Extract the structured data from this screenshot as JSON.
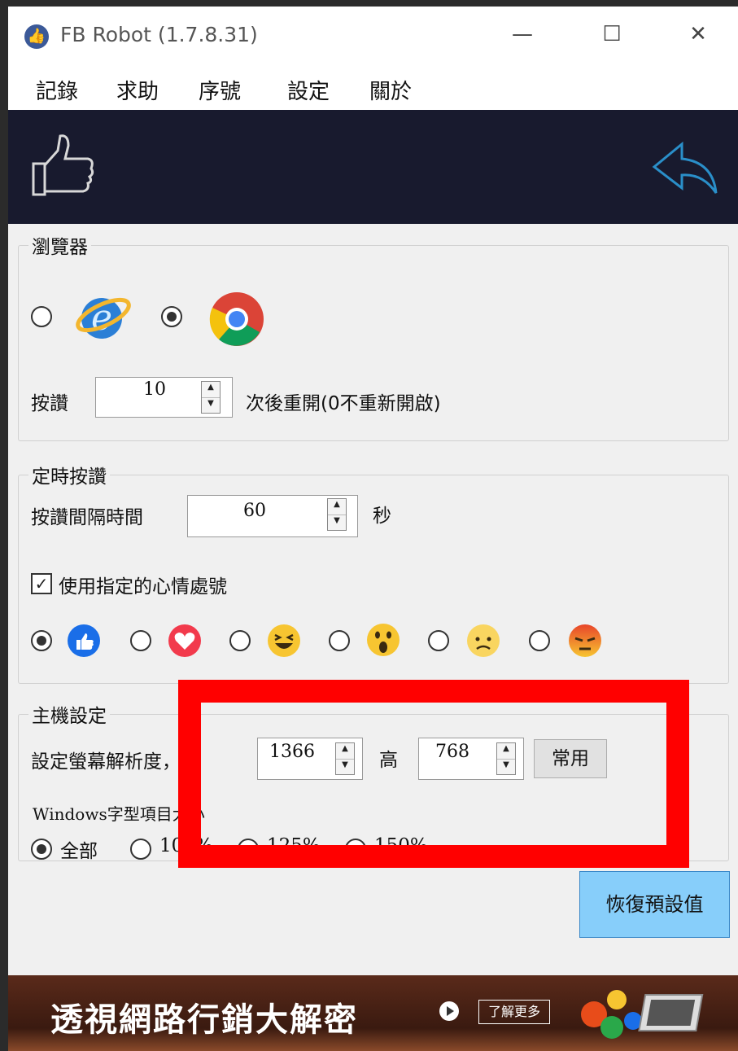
{
  "window": {
    "title": "FB Robot (1.7.8.31)",
    "minimize": "—",
    "maximize": "☐",
    "close": "✕"
  },
  "menu": [
    "記錄",
    "求助",
    "序號",
    "設定",
    "關於"
  ],
  "browser_group": {
    "title": "瀏覽器",
    "options": [
      {
        "name": "ie",
        "checked": false
      },
      {
        "name": "chrome",
        "checked": true
      }
    ],
    "restart_prefix": "按讚",
    "restart_value": "10",
    "restart_suffix": "次後重開(0不重新開啟)"
  },
  "timer_group": {
    "title": "定時按讚",
    "interval_label": "按讚間隔時間",
    "interval_value": "60",
    "interval_unit": "秒",
    "emotion_checkbox_label": "使用指定的心情處號",
    "emotion_checked": true,
    "emotions": [
      {
        "icon": "like-icon",
        "checked": true
      },
      {
        "icon": "love-icon",
        "checked": false
      },
      {
        "icon": "haha-icon",
        "checked": false
      },
      {
        "icon": "wow-icon",
        "checked": false
      },
      {
        "icon": "sad-icon",
        "checked": false
      },
      {
        "icon": "angry-icon",
        "checked": false
      }
    ]
  },
  "host_group": {
    "title": "主機設定",
    "resolution_label": "設定螢幕解析度，寬",
    "width_value": "1366",
    "height_label": "高",
    "height_value": "768",
    "common_button": "常用",
    "font_size_label": "Windows字型項目大小",
    "font_options": [
      {
        "label": "全部",
        "checked": true
      },
      {
        "label": "100%",
        "checked": false
      },
      {
        "label": "125%",
        "checked": false
      },
      {
        "label": "150%",
        "checked": false
      }
    ]
  },
  "reset_button": "恢復預設值",
  "ad": {
    "text": "透視網路行銷大解密",
    "button": "了解更多"
  },
  "colors": {
    "banner_bg": "#181a2e",
    "highlight_box": "#ff0000",
    "reset_button_bg": "#87cefa",
    "facebook_blue": "#3b5998"
  }
}
